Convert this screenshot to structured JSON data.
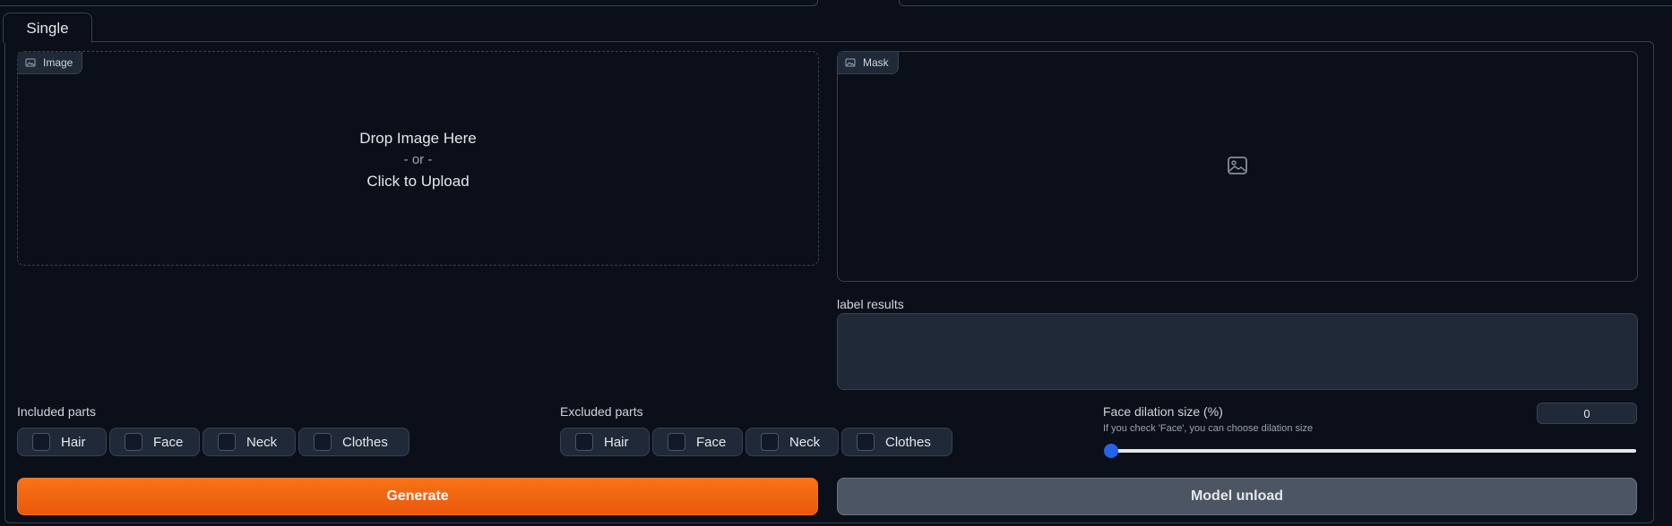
{
  "tabs": [
    {
      "label": "Single"
    }
  ],
  "image_upload": {
    "label": "Image",
    "drop_text": "Drop Image Here",
    "or_text": "- or -",
    "click_text": "Click to Upload"
  },
  "mask": {
    "label": "Mask"
  },
  "label_results": {
    "label": "label results",
    "value": ""
  },
  "included_parts": {
    "title": "Included parts",
    "options": [
      "Hair",
      "Face",
      "Neck",
      "Clothes"
    ]
  },
  "excluded_parts": {
    "title": "Excluded parts",
    "options": [
      "Hair",
      "Face",
      "Neck",
      "Clothes"
    ]
  },
  "face_dilation": {
    "title": "Face dilation size (%)",
    "info": "If you check 'Face', you can choose dilation size",
    "value": "0",
    "fraction": 0
  },
  "buttons": {
    "generate": "Generate",
    "model_unload": "Model unload"
  },
  "colors": {
    "background": "#0b0f19",
    "accent": "#f97316",
    "slider": "#2563eb"
  },
  "icons": {
    "image_chip": "image-icon",
    "mask_placeholder": "image-placeholder-icon"
  }
}
